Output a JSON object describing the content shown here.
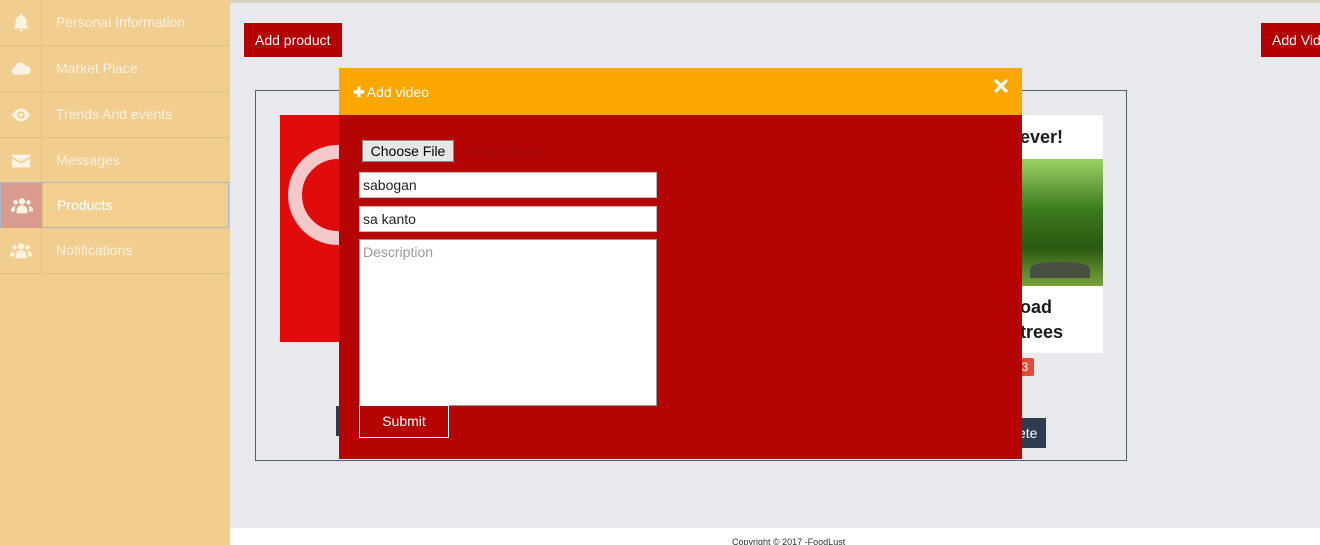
{
  "sidebar": {
    "items": [
      {
        "label": "Personal Information",
        "icon": "bell-icon"
      },
      {
        "label": "Market Place",
        "icon": "cloud-icon"
      },
      {
        "label": "Trends And events",
        "icon": "eye-icon"
      },
      {
        "label": "Messages",
        "icon": "envelope-icon"
      },
      {
        "label": "Products",
        "icon": "users-icon",
        "active": true
      },
      {
        "label": "Notifications",
        "icon": "users-icon"
      }
    ]
  },
  "main": {
    "add_product_label": "Add product",
    "add_video_label": "Add Vid",
    "poster_line1": "ever!",
    "poster_line2": "oad",
    "poster_line3": "trees",
    "badge_count": "3",
    "delete_label": "ete"
  },
  "modal": {
    "title": "Add video",
    "file_button": "Choose File",
    "file_status": "No file chosen",
    "name_value": "sabogan",
    "location_value": "sa kanto",
    "description_placeholder": "Description",
    "submit_label": "Submit"
  },
  "footer": {
    "copyright": "Copyright © 2017 -FoodLust"
  },
  "colors": {
    "sidebar_bg": "#f1ce8f",
    "modal_header": "#fca600",
    "modal_body": "#b40404",
    "accent_red": "#b30000"
  }
}
